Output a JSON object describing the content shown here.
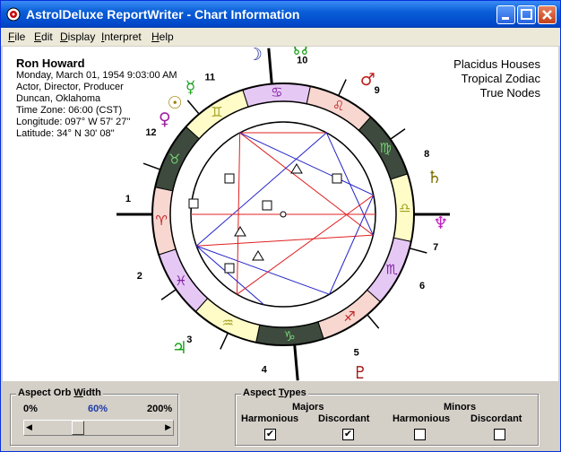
{
  "window": {
    "title": "AstrolDeluxe ReportWriter - Chart Information",
    "min_icon": "minimize-icon",
    "max_icon": "maximize-icon",
    "close_icon": "close-icon"
  },
  "menu": [
    {
      "label": "File",
      "underline": "F"
    },
    {
      "label": "Edit",
      "underline": "E"
    },
    {
      "label": "Display",
      "underline": "D"
    },
    {
      "label": "Interpret",
      "underline": "I"
    },
    {
      "label": "Help",
      "underline": "H"
    }
  ],
  "person": {
    "name": "Ron Howard",
    "date": "Monday, March 01, 1954 9:03:00 AM",
    "occupation": "Actor, Director, Producer",
    "place": "Duncan, Oklahoma",
    "timezone": "Time Zone: 06:00 (CST)",
    "longitude": "Longitude: 097° W 57' 27''",
    "latitude": "Latitude: 34° N 30' 08''"
  },
  "settings": {
    "houses": "Placidus Houses",
    "zodiac": "Tropical Zodiac",
    "nodes": "True Nodes"
  },
  "wheel": {
    "house_numbers": [
      "1",
      "2",
      "3",
      "4",
      "5",
      "6",
      "7",
      "8",
      "9",
      "10",
      "11",
      "12"
    ],
    "signs": [
      "♈",
      "♉",
      "♊",
      "♋",
      "♌",
      "♍",
      "♎",
      "♏",
      "♐",
      "♑",
      "♒",
      "♓"
    ],
    "planets": [
      "☽",
      "☊",
      "☿",
      "♀",
      "☉",
      "♂",
      "♄",
      "♆",
      "♃",
      "♅",
      "☋",
      "♇"
    ],
    "colors": {
      "fire": "#f7d7d0",
      "earth": "#3d4a3d",
      "air": "#fffcc8",
      "water": "#e6c8f5",
      "red": "#e02020",
      "blue": "#2020c8"
    }
  },
  "orb": {
    "legend": "Aspect Orb Width",
    "legend_underline": "W",
    "min": "0%",
    "current": "60%",
    "max": "200%",
    "value_pct": 60
  },
  "aspects": {
    "legend": "Aspect Types",
    "legend_underline": "T",
    "majors": "Majors",
    "minors": "Minors",
    "col1": "Harmonious",
    "col2": "Discordant",
    "col3": "Harmonious",
    "col4": "Discordant",
    "majors_harmonious": true,
    "majors_discordant": true,
    "minors_harmonious": false,
    "minors_discordant": false
  }
}
